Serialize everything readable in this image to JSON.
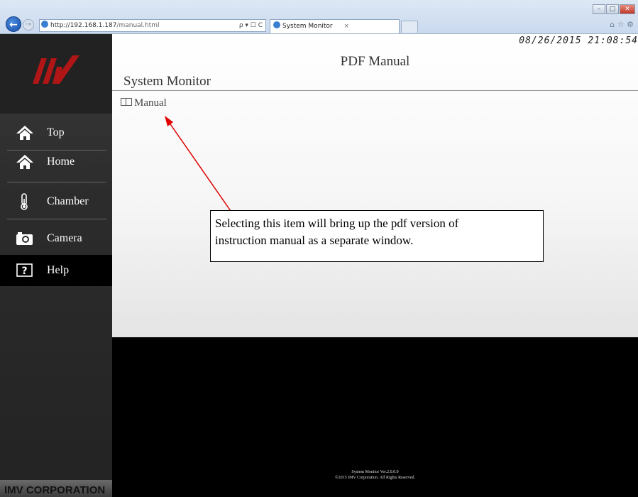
{
  "browser": {
    "url_host": "http://192.168.1.187",
    "url_path": "/manual.html",
    "address_icons": "ρ ▾ ☐ C",
    "tab_title": "System Monitor",
    "tab_close": "×",
    "right_icons": "⌂ ☆ ⚙"
  },
  "header": {
    "datetime": "08/26/2015 21:08:54",
    "page_title": "PDF Manual",
    "section_title": "System Monitor"
  },
  "main": {
    "manual_link": "Manual"
  },
  "sidebar": {
    "items": [
      {
        "label": "Top",
        "icon": "home-icon"
      },
      {
        "label": "Home",
        "icon": "home-icon"
      },
      {
        "label": "Chamber",
        "icon": "thermometer-icon"
      },
      {
        "label": "Camera",
        "icon": "camera-icon"
      },
      {
        "label": "Help",
        "icon": "help-icon"
      }
    ],
    "company": "IMV CORPORATION"
  },
  "annotation": {
    "line1": "Selecting this item will bring up the pdf version of",
    "line2": "instruction manual as a separate window."
  },
  "footer": {
    "version": "System Monitor Ver.2.0.0.0",
    "copyright": "©2015 IMV Corporation. All Rights Reserved."
  },
  "colors": {
    "logo_red": "#b01616",
    "active_nav": "#000000",
    "arrow": "#e00000"
  }
}
